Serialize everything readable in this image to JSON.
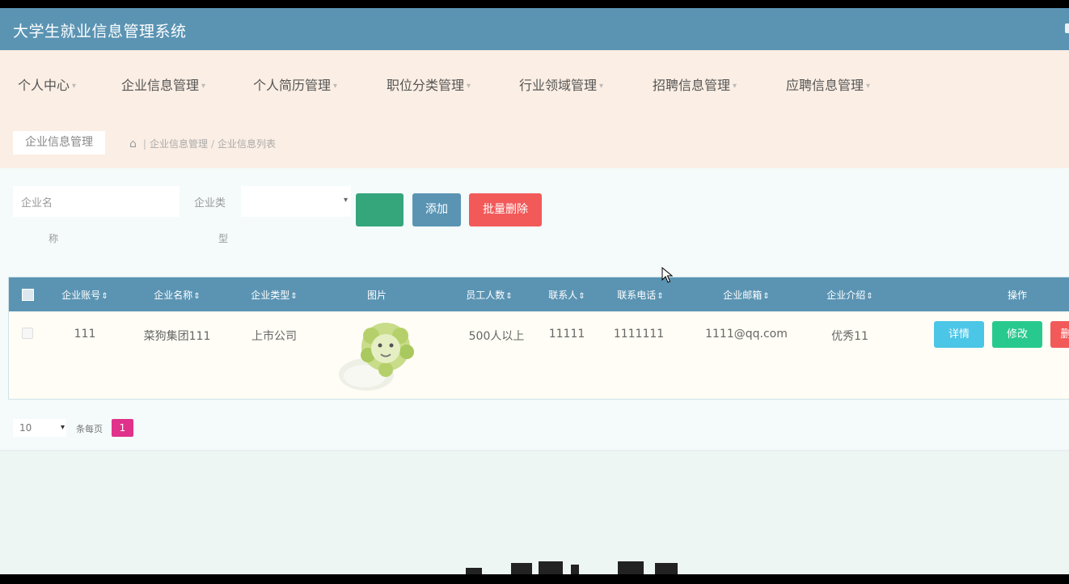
{
  "app": {
    "title": "大学生就业信息管理系统"
  },
  "menu": [
    {
      "label": "个人中心"
    },
    {
      "label": "企业信息管理"
    },
    {
      "label": "个人简历管理"
    },
    {
      "label": "职位分类管理"
    },
    {
      "label": "行业领域管理"
    },
    {
      "label": "招聘信息管理"
    },
    {
      "label": "应聘信息管理"
    }
  ],
  "breadcrumb": {
    "chip": "企业信息管理",
    "path": [
      "企业信息管理",
      "企业信息列表"
    ]
  },
  "search": {
    "company_name_placeholder": "企业名",
    "company_name_sub": "称",
    "company_type_label": "企业类",
    "company_type_sub": "型",
    "company_type_value": ""
  },
  "buttons": {
    "search": "",
    "add": "添加",
    "batch_delete": "批量删除"
  },
  "table": {
    "columns": [
      "企业账号",
      "企业名称",
      "企业类型",
      "图片",
      "员工人数",
      "联系人",
      "联系电话",
      "企业邮箱",
      "企业介绍",
      "操作"
    ],
    "rows": [
      {
        "account": "111",
        "name": "菜狗集团111",
        "type": "上市公司",
        "picture": "lion-cabbage-image",
        "employees": "500人以上",
        "contact": "11111",
        "phone": "1111111",
        "email": "1111@qq.com",
        "intro": "优秀11",
        "actions": {
          "detail": "详情",
          "edit": "修改",
          "delete": "删除"
        }
      }
    ]
  },
  "pagination": {
    "page_size": "10",
    "label": "条每页",
    "current_page": "1"
  },
  "colors": {
    "header": "#5b94b3",
    "menu_band": "#fbeee4",
    "search_btn": "#35a57c",
    "add_btn": "#5b94b3",
    "delete_btn": "#f25a5a",
    "detail_btn": "#4cc6e6",
    "edit_btn": "#28c98f",
    "current_page": "#e0328a"
  }
}
